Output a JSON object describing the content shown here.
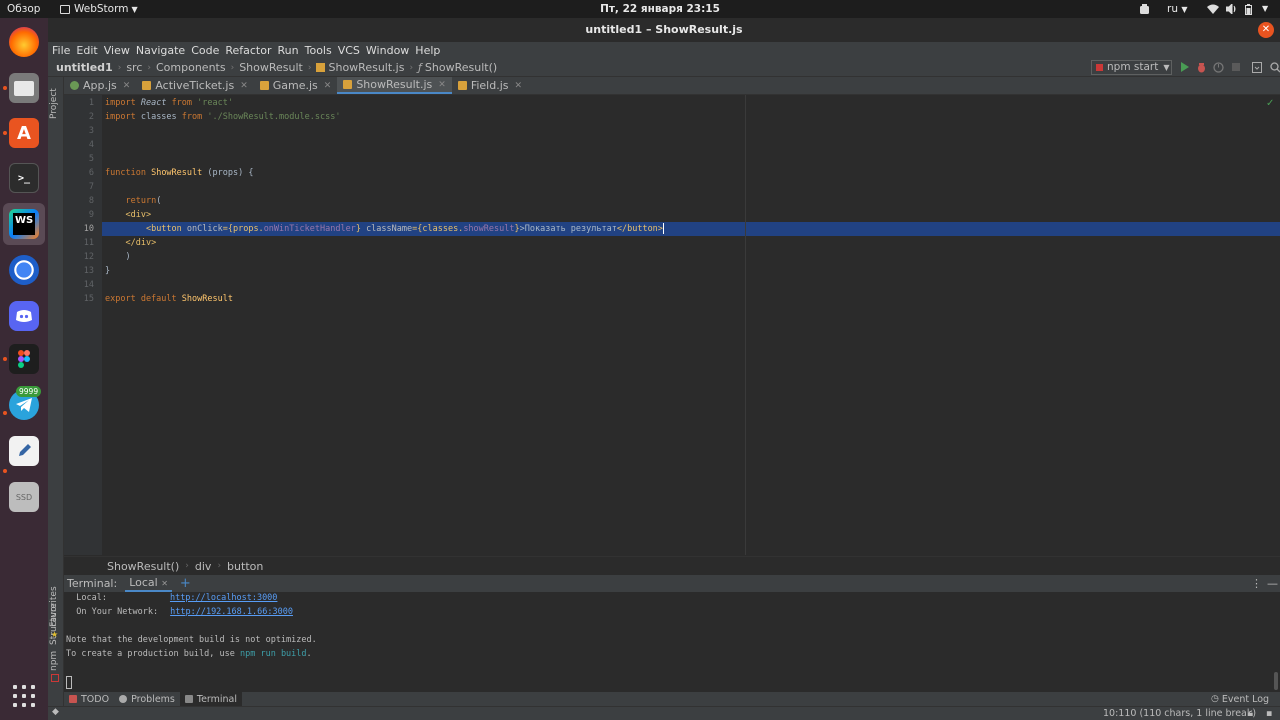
{
  "topbar": {
    "activities": "Обзор",
    "app_menu": "WebStorm",
    "clock": "Пт, 22 января  23:15",
    "lang": "ru"
  },
  "dock": {
    "badge_count": "9999",
    "ssd_label": "SSD",
    "ws_label": "WS"
  },
  "window": {
    "title": "untitled1 – ShowResult.js"
  },
  "menu": [
    "File",
    "Edit",
    "View",
    "Navigate",
    "Code",
    "Refactor",
    "Run",
    "Tools",
    "VCS",
    "Window",
    "Help"
  ],
  "nav": {
    "project": "untitled1",
    "crumbs": [
      "src",
      "Components",
      "ShowResult",
      "ShowResult.js",
      "ShowResult()"
    ],
    "run_config": "npm start"
  },
  "tabs": [
    {
      "label": "App.js",
      "color": "#6a9955"
    },
    {
      "label": "ActiveTicket.js",
      "color": "#d8a13b"
    },
    {
      "label": "Game.js",
      "color": "#d8a13b"
    },
    {
      "label": "ShowResult.js",
      "color": "#d8a13b"
    },
    {
      "label": "Field.js",
      "color": "#d8a13b"
    }
  ],
  "tool_strip": {
    "project": "Project",
    "structure": "Structure",
    "favorites": "Favorites",
    "npm": "npm"
  },
  "line_numbers": [
    "1",
    "2",
    "3",
    "4",
    "5",
    "6",
    "7",
    "8",
    "9",
    "10",
    "11",
    "12",
    "13",
    "14",
    "15"
  ],
  "code": {
    "l1_import": "import",
    "l1_name": "React",
    "l1_from": "from",
    "l1_str": "'react'",
    "l2_import": "import",
    "l2_name": " classes ",
    "l2_from": "from",
    "l2_str": "'./ShowResult.module.scss'",
    "l6_kw": "function",
    "l6_fn": "ShowResult",
    "l6_rest": " (props) {",
    "l8_kw": "return",
    "l8_rest": "(",
    "l9_tag": "<div>",
    "l10_open": "<button ",
    "l10_attr1": "onClick",
    "l10_val1a": "={props.",
    "l10_val1b": "onWinTicketHandler",
    "l10_val1c": "} ",
    "l10_attr2": "className",
    "l10_val2a": "={classes.",
    "l10_val2b": "showResult",
    "l10_val2c": "}",
    "l10_text": ">Показать результат",
    "l10_close": "</button>",
    "l11_tag": "</div>",
    "l12": ")",
    "l13": "}",
    "l15_kw": "export default",
    "l15_name": " ShowResult"
  },
  "breadcrumb": [
    "ShowResult()",
    "div",
    "button"
  ],
  "terminal": {
    "label": "Terminal:",
    "tab": "Local",
    "local_label": "  Local:",
    "local_url": "http://localhost:3000",
    "network_label": "  On Your Network:",
    "network_url": "http://192.168.1.66:3000",
    "note": "Note that the development build is not optimized.",
    "prod_prefix": "To create a production build, use ",
    "prod_cmd": "npm run build",
    "prod_suffix": "."
  },
  "bottom_tools": [
    "TODO",
    "Problems",
    "Terminal"
  ],
  "event_log": "Event Log",
  "status": "10:110 (110 chars, 1 line break)"
}
